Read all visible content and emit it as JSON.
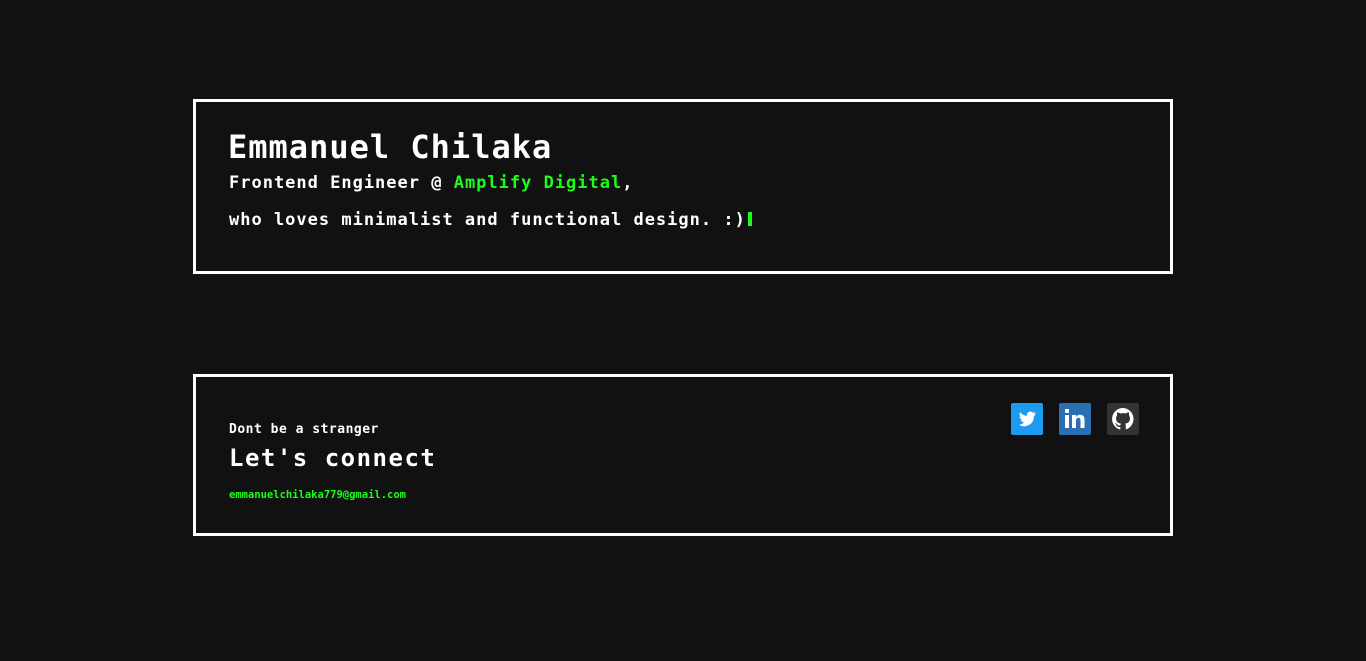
{
  "intro": {
    "name": "Emmanuel Chilaka",
    "role_prefix": "Frontend Engineer @ ",
    "company": "Amplify Digital",
    "role_suffix": ",",
    "tagline": "who loves minimalist and functional design. :)"
  },
  "connect": {
    "eyebrow": "Dont be a stranger",
    "title": "Let's connect",
    "email": "emmanuelchilaka779@gmail.com"
  },
  "socials": [
    {
      "name": "twitter-icon",
      "color": "#1d9bf0"
    },
    {
      "name": "linkedin-icon",
      "color": "#2a6fb4"
    },
    {
      "name": "github-icon",
      "color": "#333333"
    }
  ],
  "colors": {
    "background": "#111111",
    "border": "#ffffff",
    "accent": "#1aff1a"
  }
}
